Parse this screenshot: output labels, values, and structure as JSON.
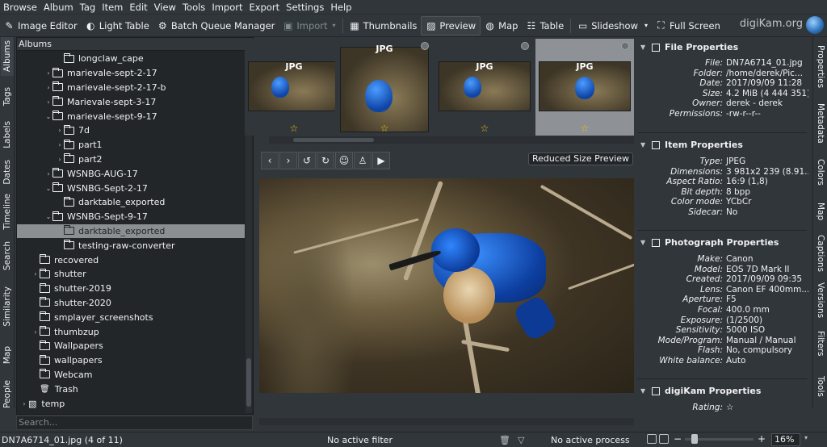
{
  "menu": [
    "Browse",
    "Album",
    "Tag",
    "Item",
    "Edit",
    "View",
    "Tools",
    "Import",
    "Export",
    "Settings",
    "Help"
  ],
  "toolbar": {
    "image_editor": "Image Editor",
    "light_table": "Light Table",
    "batch_queue": "Batch Queue Manager",
    "import": "Import",
    "thumbnails": "Thumbnails",
    "preview": "Preview",
    "map": "Map",
    "table": "Table",
    "slideshow": "Slideshow",
    "full_screen": "Full Screen",
    "brand": "digiKam.org"
  },
  "left_tabs": [
    "Albums",
    "Tags",
    "Labels",
    "Dates",
    "Timeline",
    "Search",
    "Similarity",
    "Map",
    "People"
  ],
  "right_tabs": [
    "Properties",
    "Metadata",
    "Colors",
    "Map",
    "Captions",
    "Versions",
    "Filters",
    "Tools"
  ],
  "tree": {
    "header": "Albums",
    "rows": [
      {
        "label": "longclaw_cape",
        "depth": 3,
        "arrow": ""
      },
      {
        "label": "marievale-sept-2-17",
        "depth": 2,
        "arrow": "›"
      },
      {
        "label": "marievale-sept-2-17-b",
        "depth": 2,
        "arrow": "›"
      },
      {
        "label": "Marievale-sept-3-17",
        "depth": 2,
        "arrow": "›"
      },
      {
        "label": "marievale-sept-9-17",
        "depth": 2,
        "arrow": "⌄"
      },
      {
        "label": "7d",
        "depth": 3,
        "arrow": "›"
      },
      {
        "label": "part1",
        "depth": 3,
        "arrow": "›"
      },
      {
        "label": "part2",
        "depth": 3,
        "arrow": "›"
      },
      {
        "label": "WSNBG-AUG-17",
        "depth": 2,
        "arrow": "›"
      },
      {
        "label": "WSNBG-Sept-2-17",
        "depth": 2,
        "arrow": "⌄"
      },
      {
        "label": "darktable_exported",
        "depth": 3,
        "arrow": ""
      },
      {
        "label": "WSNBG-Sept-9-17",
        "depth": 2,
        "arrow": "⌄"
      },
      {
        "label": "darktable_exported",
        "depth": 3,
        "arrow": "",
        "selected": true
      },
      {
        "label": "testing-raw-converter",
        "depth": 3,
        "arrow": ""
      },
      {
        "label": "recovered",
        "depth": 1,
        "arrow": ""
      },
      {
        "label": "shutter",
        "depth": 1,
        "arrow": "›"
      },
      {
        "label": "shutter-2019",
        "depth": 1,
        "arrow": ""
      },
      {
        "label": "shutter-2020",
        "depth": 1,
        "arrow": ""
      },
      {
        "label": "smplayer_screenshots",
        "depth": 1,
        "arrow": ""
      },
      {
        "label": "thumbzup",
        "depth": 1,
        "arrow": "›"
      },
      {
        "label": "Wallpapers",
        "depth": 1,
        "arrow": ""
      },
      {
        "label": "wallpapers",
        "depth": 1,
        "arrow": ""
      },
      {
        "label": "Webcam",
        "depth": 1,
        "arrow": ""
      },
      {
        "label": "Trash",
        "depth": 1,
        "arrow": "",
        "icon": "trash-icon"
      },
      {
        "label": "temp",
        "depth": 0,
        "arrow": "›",
        "icon": "image-icon"
      }
    ],
    "search_placeholder": "Search..."
  },
  "thumbnails": [
    {
      "badge": "JPG",
      "rating": "☆"
    },
    {
      "badge": "JPG",
      "rating": "☆"
    },
    {
      "badge": "JPG",
      "rating": "☆"
    },
    {
      "badge": "JPG",
      "rating": "☆"
    }
  ],
  "preview": {
    "reduced_label": "Reduced Size Preview"
  },
  "properties": {
    "file": {
      "title": "File Properties",
      "rows": [
        {
          "k": "File:",
          "v": "DN7A6714_01.jpg"
        },
        {
          "k": "Folder:",
          "v": "/home/derek/Pic..."
        },
        {
          "k": "Date:",
          "v": "2017/09/09 11:28"
        },
        {
          "k": "Size:",
          "v": "4.2 MiB (4 444 351)"
        },
        {
          "k": "Owner:",
          "v": "derek - derek"
        },
        {
          "k": "Permissions:",
          "v": "-rw-r--r--"
        }
      ]
    },
    "item": {
      "title": "Item Properties",
      "rows": [
        {
          "k": "Type:",
          "v": "JPEG"
        },
        {
          "k": "Dimensions:",
          "v": "3 981x2 239 (8.91..."
        },
        {
          "k": "Aspect Ratio:",
          "v": "16:9 (1,8)"
        },
        {
          "k": "Bit depth:",
          "v": "8 bpp"
        },
        {
          "k": "Color mode:",
          "v": "YCbCr"
        },
        {
          "k": "Sidecar:",
          "v": "No"
        }
      ]
    },
    "photo": {
      "title": "Photograph Properties",
      "rows": [
        {
          "k": "Make:",
          "v": "Canon"
        },
        {
          "k": "Model:",
          "v": "EOS 7D Mark II"
        },
        {
          "k": "Created:",
          "v": "2017/09/09 09:35"
        },
        {
          "k": "Lens:",
          "v": "Canon EF 400mm..."
        },
        {
          "k": "Aperture:",
          "v": "F5"
        },
        {
          "k": "Focal:",
          "v": "400.0 mm"
        },
        {
          "k": "Exposure:",
          "v": "(1/2500)"
        },
        {
          "k": "Sensitivity:",
          "v": "5000 ISO"
        },
        {
          "k": "Mode/Program:",
          "v": "Manual / Manual"
        },
        {
          "k": "Flash:",
          "v": "No, compulsory"
        },
        {
          "k": "White balance:",
          "v": "Auto"
        }
      ]
    },
    "digikam": {
      "title": "digiKam Properties",
      "rows": [
        {
          "k": "Rating:",
          "v": "☆"
        }
      ]
    }
  },
  "status": {
    "file_info": "DN7A6714_01.jpg (4 of 11)",
    "filter": "No active filter",
    "process": "No active process",
    "zoom": "16%"
  }
}
